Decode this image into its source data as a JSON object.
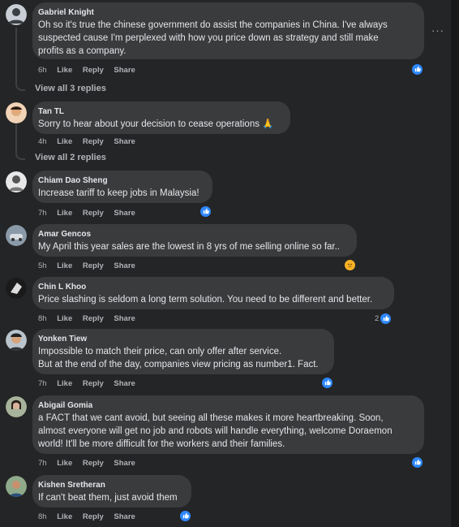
{
  "comments": [
    {
      "author": "Gabriel Knight",
      "lines": [
        "Oh so it's true the chinese government do assist the companies in China. I've always",
        "suspected cause I'm perplexed with how you price down as strategy and still make",
        "profits as a company."
      ],
      "time": "6h",
      "like": "Like",
      "reply": "Reply",
      "share": "Share",
      "reaction": "like",
      "reaction_count": ""
    },
    {
      "author": "Tan TL",
      "lines": [
        "Sorry to hear about your decision to cease operations 🙏"
      ],
      "time": "4h",
      "like": "Like",
      "reply": "Reply",
      "share": "Share",
      "reaction": "",
      "reaction_count": ""
    },
    {
      "author": "Chiam Dao Sheng",
      "lines": [
        "Increase tariff to keep jobs in Malaysia!"
      ],
      "time": "7h",
      "like": "Like",
      "reply": "Reply",
      "share": "Share",
      "reaction": "like",
      "reaction_count": ""
    },
    {
      "author": "Amar Gencos",
      "lines": [
        "My April this year sales are the lowest in 8 yrs of me selling online so far.."
      ],
      "time": "5h",
      "like": "Like",
      "reply": "Reply",
      "share": "Share",
      "reaction": "sad",
      "reaction_count": ""
    },
    {
      "author": "Chin L Khoo",
      "lines": [
        "Price slashing is seldom a long term solution. You need to be different and better."
      ],
      "time": "8h",
      "like": "Like",
      "reply": "Reply",
      "share": "Share",
      "reaction": "like",
      "reaction_count": "2"
    },
    {
      "author": "Yonken Tiew",
      "lines": [
        "Impossible to match their price, can only offer after service.",
        "But at the end of the day, companies view pricing as number1. Fact."
      ],
      "time": "7h",
      "like": "Like",
      "reply": "Reply",
      "share": "Share",
      "reaction": "like",
      "reaction_count": ""
    },
    {
      "author": "Abigail Gomia",
      "lines": [
        "a FACT that we cant avoid, but seeing all these makes it more heartbreaking. Soon,",
        "almost everyone will get no job and robots will handle everything, welcome Doraemon",
        "world! It'll be more difficult for the workers and their families."
      ],
      "time": "7h",
      "like": "Like",
      "reply": "Reply",
      "share": "Share",
      "reaction": "like",
      "reaction_count": ""
    },
    {
      "author": "Kishen Sretheran",
      "lines": [
        "If can't beat them, just avoid them"
      ],
      "time": "8h",
      "like": "Like",
      "reply": "Reply",
      "share": "Share",
      "reaction": "like",
      "reaction_count": ""
    }
  ],
  "view_replies": [
    "View all 3 replies",
    "View all 2 replies"
  ],
  "more_menu": "···",
  "colors": {
    "background": "#242526",
    "bubble": "#3a3b3c",
    "like_blue": "#2d88ff",
    "text": "#e4e6eb",
    "muted": "#b0b3b8"
  }
}
